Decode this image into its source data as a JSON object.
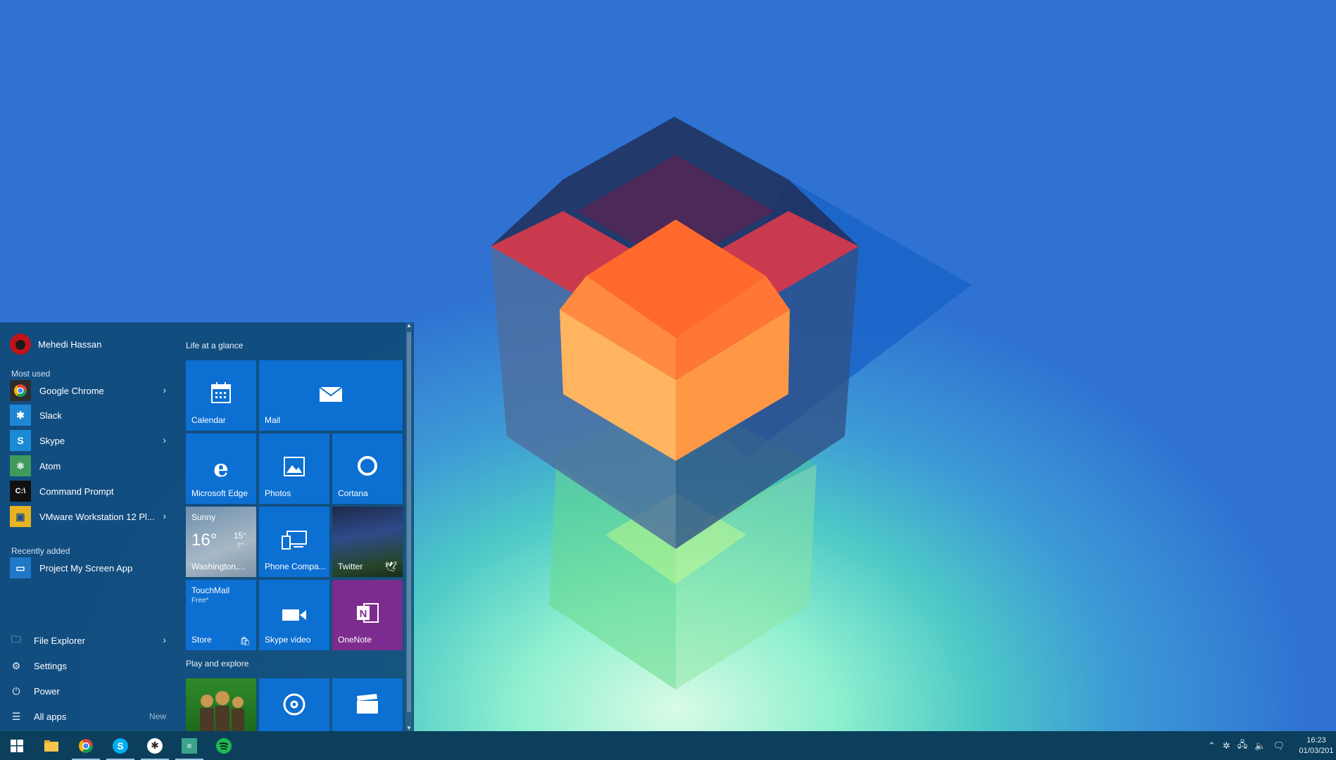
{
  "user": {
    "name": "Mehedi Hassan"
  },
  "sections": {
    "most_used": "Most used",
    "recently_added": "Recently added"
  },
  "most_used": [
    {
      "label": "Google Chrome",
      "icon": "chrome-icon",
      "bg": "#2d2d2d",
      "has_submenu": true
    },
    {
      "label": "Slack",
      "icon": "slack-icon",
      "bg": "#1f86d6",
      "has_submenu": false
    },
    {
      "label": "Skype",
      "icon": "skype-icon",
      "bg": "#1a8ad4",
      "has_submenu": true
    },
    {
      "label": "Atom",
      "icon": "atom-icon",
      "bg": "#3f9a5b",
      "has_submenu": false
    },
    {
      "label": "Command Prompt",
      "icon": "cmd-icon",
      "bg": "#111111",
      "has_submenu": false
    },
    {
      "label": "VMware Workstation 12 Pl...",
      "icon": "vmware-icon",
      "bg": "#e8b321",
      "has_submenu": true
    }
  ],
  "recently_added": [
    {
      "label": "Project My Screen App",
      "icon": "project-screen-icon",
      "bg": "#1f78c8"
    }
  ],
  "bottom": {
    "file_explorer": "File Explorer",
    "settings": "Settings",
    "power": "Power",
    "all_apps": "All apps",
    "new_badge": "New"
  },
  "groups": {
    "life": "Life at a glance",
    "play": "Play and explore"
  },
  "tiles": {
    "calendar": "Calendar",
    "mail": "Mail",
    "edge": "Microsoft Edge",
    "photos": "Photos",
    "cortana": "Cortana",
    "weather_condition": "Sunny",
    "weather_temp": "16°",
    "weather_high": "15°",
    "weather_low": "7°",
    "weather_location": "Washington,...",
    "phone": "Phone Compa...",
    "twitter": "Twitter",
    "store_app": "TouchMail",
    "store_price": "Free*",
    "store": "Store",
    "skype_video": "Skype video",
    "onenote": "OneNote"
  },
  "clock": {
    "time": "16:23",
    "date": "01/03/201"
  },
  "colors": {
    "tile_blue": "#0c6fd2",
    "onenote_purple": "#7b2c8e",
    "taskbar": "#0c3f5c"
  }
}
